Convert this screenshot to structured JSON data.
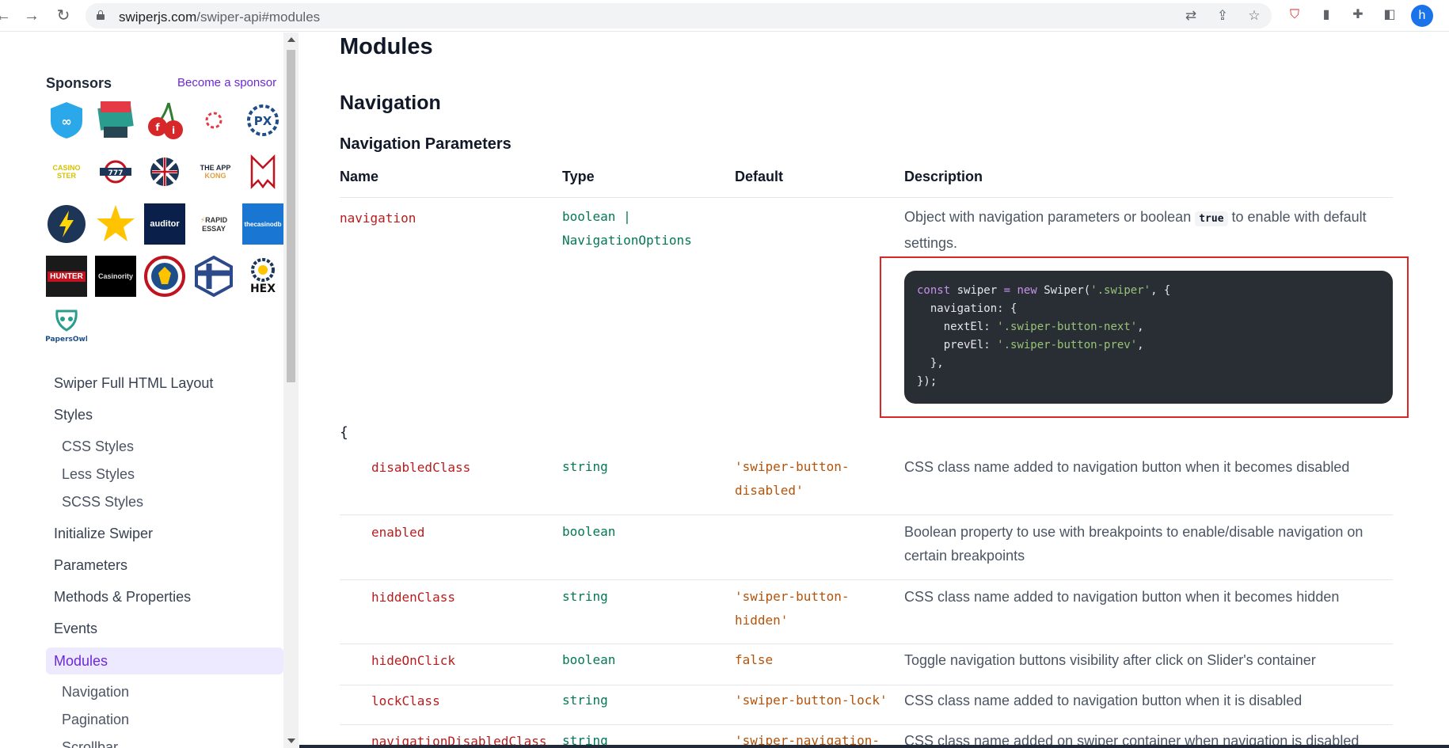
{
  "browser": {
    "url_host": "swiperjs.com",
    "url_path": "/swiper-api#modules",
    "profile_initial": "h"
  },
  "sidebar": {
    "sponsors_title": "Sponsors",
    "become_sponsor": "Become a sponsor",
    "logos": [
      "VPN",
      "CASINOTEST",
      "fi",
      "p",
      "PX",
      "CASINOSTER",
      "777",
      "UK",
      "THE APP KONG",
      "M",
      "bolt",
      "star",
      "auditor",
      "RAPID ESSAY",
      "thecasinodb",
      "HUNTER",
      "Casinority",
      "shield",
      "cross",
      "HEX",
      "PapersOwl"
    ],
    "items": [
      {
        "label": "Swiper Full HTML Layout",
        "level": 1
      },
      {
        "label": "Styles",
        "level": 1
      },
      {
        "label": "CSS Styles",
        "level": 2
      },
      {
        "label": "Less Styles",
        "level": 2
      },
      {
        "label": "SCSS Styles",
        "level": 2
      },
      {
        "label": "Initialize Swiper",
        "level": 1
      },
      {
        "label": "Parameters",
        "level": 1
      },
      {
        "label": "Methods & Properties",
        "level": 1
      },
      {
        "label": "Events",
        "level": 1
      },
      {
        "label": "Modules",
        "level": 1,
        "active": true
      },
      {
        "label": "Navigation",
        "level": 2
      },
      {
        "label": "Pagination",
        "level": 2
      },
      {
        "label": "Scrollbar",
        "level": 2
      }
    ]
  },
  "main": {
    "title": "Modules",
    "section_title": "Navigation",
    "subsection_title": "Navigation Parameters",
    "columns": [
      "Name",
      "Type",
      "Default",
      "Description"
    ],
    "navigation_row": {
      "name": "navigation",
      "type_line1": "boolean |",
      "type_line2": "NavigationOptions",
      "desc_before": "Object with navigation parameters or boolean ",
      "desc_code": "true",
      "desc_after": " to enable with default settings."
    },
    "code_lines": [
      "const swiper = new Swiper('.swiper', {",
      "  navigation: {",
      "    nextEl: '.swiper-button-next',",
      "    prevEl: '.swiper-button-prev',",
      "  },",
      "});"
    ],
    "open_brace": "{",
    "rows": [
      {
        "name": "disabledClass",
        "type": "string",
        "default_line1": "'swiper-button-",
        "default_line2": "disabled'",
        "description": "CSS class name added to navigation button when it becomes disabled"
      },
      {
        "name": "enabled",
        "type": "boolean",
        "default_line1": "",
        "default_line2": "",
        "description": "Boolean property to use with breakpoints to enable/disable navigation on certain breakpoints"
      },
      {
        "name": "hiddenClass",
        "type": "string",
        "default_line1": "'swiper-button-",
        "default_line2": "hidden'",
        "description": "CSS class name added to navigation button when it becomes hidden"
      },
      {
        "name": "hideOnClick",
        "type": "boolean",
        "default_line1": "false",
        "default_line2": "",
        "description": "Toggle navigation buttons visibility after click on Slider's container"
      },
      {
        "name": "lockClass",
        "type": "string",
        "default_line1": "'swiper-button-lock'",
        "default_line2": "",
        "description": "CSS class name added to navigation button when it is disabled"
      },
      {
        "name": "navigationDisabledClass",
        "type": "string",
        "default_line1": "'swiper-navigation-",
        "default_line2": "",
        "description": "CSS class name added on swiper container when navigation is disabled"
      }
    ]
  }
}
